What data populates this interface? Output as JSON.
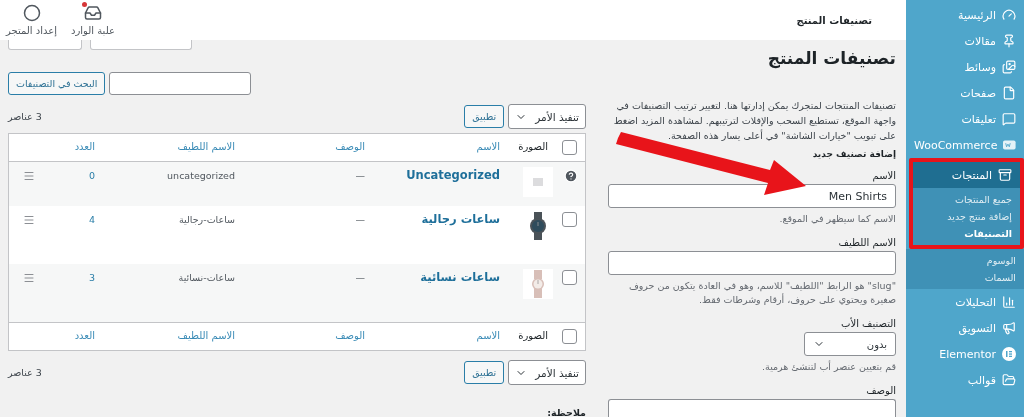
{
  "header": {
    "title": "تصنيفات المنتج",
    "actions": [
      {
        "label": "علبة الوارد",
        "kind": "inbox",
        "unread": true
      },
      {
        "label": "إعداد المتجر",
        "kind": "setup",
        "unread": false
      }
    ]
  },
  "sidebar": {
    "items": [
      {
        "label": "الرئيسية",
        "kind": "dashboard",
        "selected": false,
        "highlighted": false
      },
      {
        "label": "مقالات",
        "kind": "pin",
        "selected": false,
        "highlighted": false
      },
      {
        "label": "وسائط",
        "kind": "media",
        "selected": false,
        "highlighted": false
      },
      {
        "label": "صفحات",
        "kind": "pages",
        "selected": false,
        "highlighted": false
      },
      {
        "label": "تعليقات",
        "kind": "comments",
        "selected": false,
        "highlighted": false
      },
      {
        "label": "WooCommerce",
        "kind": "woo",
        "selected": false,
        "highlighted": false
      },
      {
        "label": "المنتجات",
        "kind": "products",
        "selected": true,
        "highlighted": true,
        "children": [
          {
            "label": "جميع المنتجات",
            "selected": false,
            "highlighted": true
          },
          {
            "label": "إضافة منتج جديد",
            "selected": false,
            "highlighted": true
          },
          {
            "label": "التصنيفات",
            "selected": true,
            "highlighted": true
          },
          {
            "label": "الوسوم",
            "selected": false,
            "highlighted": false
          },
          {
            "label": "السمات",
            "selected": false,
            "highlighted": false
          }
        ]
      },
      {
        "label": "التحليلات",
        "kind": "analytics",
        "selected": false,
        "highlighted": false
      },
      {
        "label": "التسويق",
        "kind": "marketing",
        "selected": false,
        "highlighted": false
      },
      {
        "label": "Elementor",
        "kind": "elementor",
        "selected": false,
        "highlighted": false
      },
      {
        "label": "قوالب",
        "kind": "folder",
        "selected": false,
        "highlighted": false
      }
    ]
  },
  "form": {
    "title": "تصنيفات المنتج",
    "intro": "تصنيفات المنتجات لمتجرك يمكن إدارتها هنا. لتغيير ترتيب التصنيفات في واجهة الموقع، تستطيع السحب والإفلات لترتيبهم. لمشاهدة المزيد اضغط على تبويب \"خيارات الشاشة\" في أعلى يسار هذه الصفحة.",
    "heading": "إضافة تصنيف جديد",
    "fields": [
      {
        "kind": "text",
        "label": "الاسم",
        "value": "Men Shirts",
        "help": "الاسم كما سيظهر في الموقع."
      },
      {
        "kind": "text",
        "label": "الاسم اللطيف",
        "help": "\"slug\" هو الرابط \"اللطيف\" للاسم، وهو في العادة يتكون من حروف صغيرة ويحتوي على حروف، أرقام وشرطات فقط."
      },
      {
        "kind": "select",
        "label": "التصنيف الأب",
        "value": "بدون",
        "help": "قم بتعيين عنصر أب لتنشئ هرمية."
      },
      {
        "kind": "textarea",
        "label": "الوصف"
      }
    ]
  },
  "search": {
    "button": "البحث في التصنيفات"
  },
  "bulk_top": {
    "action": "تنفيذ الأمر",
    "apply": "تطبيق",
    "count": "3 عناصر"
  },
  "table": {
    "columns": [
      "الصورة",
      "الاسم",
      "الوصف",
      "الاسم اللطيف",
      "العدد"
    ],
    "select_all_checked": false,
    "rows": [
      {
        "kind": "default",
        "name": "Uncategorized",
        "description": "—",
        "slug": "uncategorized",
        "count": "0"
      },
      {
        "kind": "normal",
        "checked": false,
        "name": "ساعات رجالية",
        "description": "—",
        "slug": "ساعات-رجالية",
        "count": "4"
      },
      {
        "kind": "normal",
        "checked": false,
        "name": "ساعات نسائية",
        "description": "—",
        "slug": "ساعات-نسائية",
        "count": "3"
      }
    ],
    "footer_columns": [
      "الصورة",
      "الاسم",
      "الوصف",
      "الاسم اللطيف",
      "العدد"
    ],
    "footer_select_all_checked": false
  },
  "bulk_bottom": {
    "action": "تنفيذ الأمر",
    "apply": "تطبيق",
    "count": "3 عناصر"
  },
  "note": "ملاحظة:"
}
